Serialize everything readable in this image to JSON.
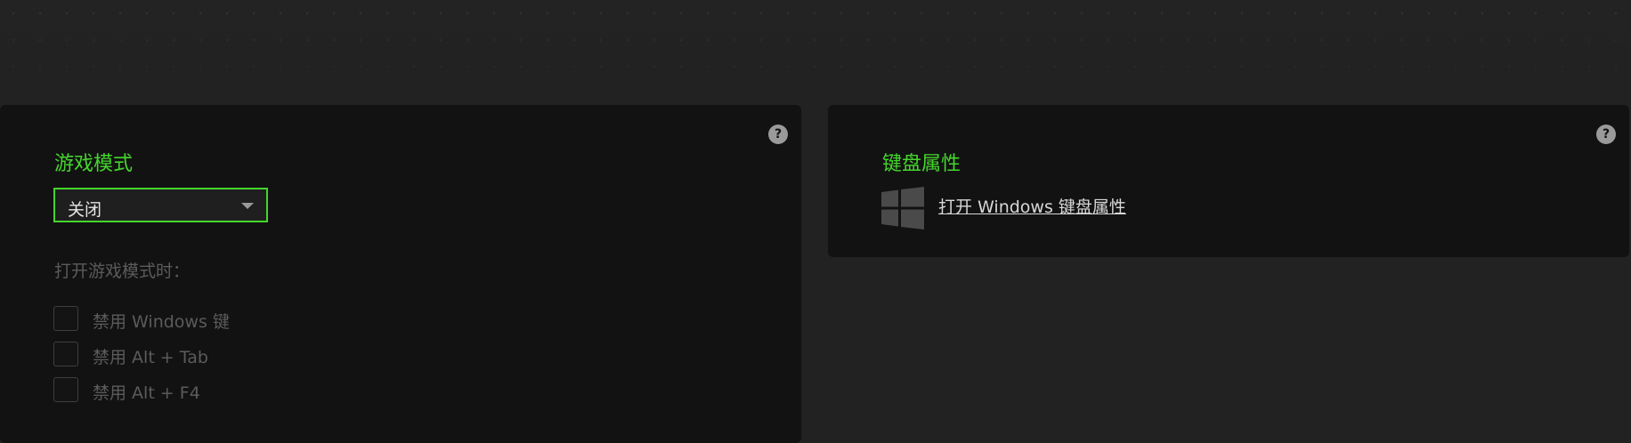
{
  "game_mode": {
    "title": "游戏模式",
    "select_value": "关闭",
    "subtitle": "打开游戏模式时：",
    "options": [
      {
        "label": "禁用 Windows 键",
        "checked": false
      },
      {
        "label": "禁用 Alt + Tab",
        "checked": false
      },
      {
        "label": "禁用 Alt + F4",
        "checked": false
      }
    ],
    "help": "?"
  },
  "keyboard_properties": {
    "title": "键盘属性",
    "link_text": "打开 Windows 键盘属性",
    "icon": "windows-logo-icon",
    "help": "?"
  },
  "colors": {
    "accent": "#44d62c",
    "panel": "#121212",
    "background": "#222222"
  }
}
